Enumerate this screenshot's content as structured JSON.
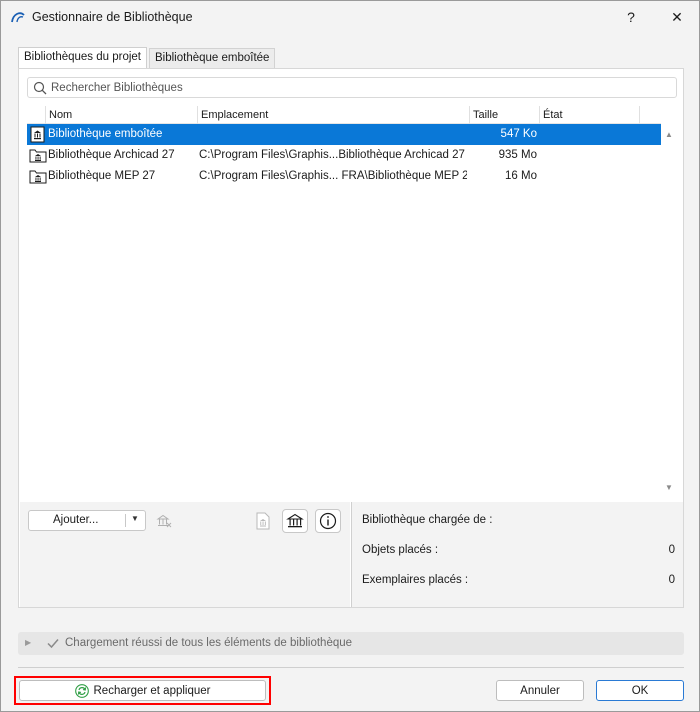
{
  "window": {
    "title": "Gestionnaire de Bibliothèque",
    "help_label": "?",
    "close_label": "✕"
  },
  "tabs": [
    {
      "label": "Bibliothèques du projet",
      "active": true
    },
    {
      "label": "Bibliothèque emboîtée",
      "active": false
    }
  ],
  "search": {
    "placeholder": "Rechercher Bibliothèques"
  },
  "list": {
    "columns": [
      "Nom",
      "Emplacement",
      "Taille",
      "État"
    ],
    "rows": [
      {
        "name": "Bibliothèque emboîtée",
        "location": "",
        "size": "547 Ko",
        "state": "",
        "selected": true,
        "icon": "embedded-library-icon"
      },
      {
        "name": "Bibliothèque Archicad 27",
        "location": "C:\\Program Files\\Graphis...Bibliothèque Archicad 27",
        "size": "935 Mo",
        "state": "",
        "selected": false,
        "icon": "folder-library-icon"
      },
      {
        "name": "Bibliothèque MEP 27",
        "location": "C:\\Program Files\\Graphis... FRA\\Bibliothèque MEP 27",
        "size": "16 Mo",
        "state": "",
        "selected": false,
        "icon": "folder-library-icon"
      }
    ]
  },
  "actions": {
    "add_label": "Ajouter..."
  },
  "info": {
    "loaded_from_label": "Bibliothèque chargée de :",
    "placed_objects_label": "Objets placés :",
    "placed_objects_value": "0",
    "placed_instances_label": "Exemplaires placés :",
    "placed_instances_value": "0"
  },
  "status": {
    "text": "Chargement réussi de tous les éléments de bibliothèque"
  },
  "footer": {
    "reload_label": "Recharger et appliquer",
    "cancel_label": "Annuler",
    "ok_label": "OK"
  },
  "colors": {
    "selection": "#0a78d7",
    "highlight": "#ff0000",
    "ok_border": "#2a7ad4"
  }
}
